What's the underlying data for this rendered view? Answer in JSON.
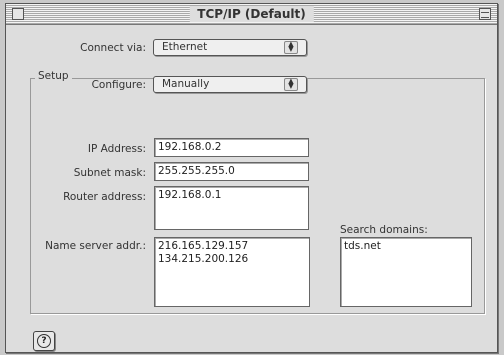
{
  "window": {
    "title": "TCP/IP (Default)"
  },
  "connect": {
    "label": "Connect via:",
    "value": "Ethernet"
  },
  "setup": {
    "group_title": "Setup",
    "configure_label": "Configure:",
    "configure_value": "Manually"
  },
  "fields": {
    "ip_label": "IP Address:",
    "ip_value": "192.168.0.2",
    "subnet_label": "Subnet mask:",
    "subnet_value": "255.255.255.0",
    "router_label": "Router address:",
    "router_value": "192.168.0.1",
    "dns_label": "Name server addr.:",
    "dns_value": "216.165.129.157\n134.215.200.126",
    "search_label": "Search domains:",
    "search_value": "tds.net"
  },
  "help": {
    "glyph": "?"
  }
}
